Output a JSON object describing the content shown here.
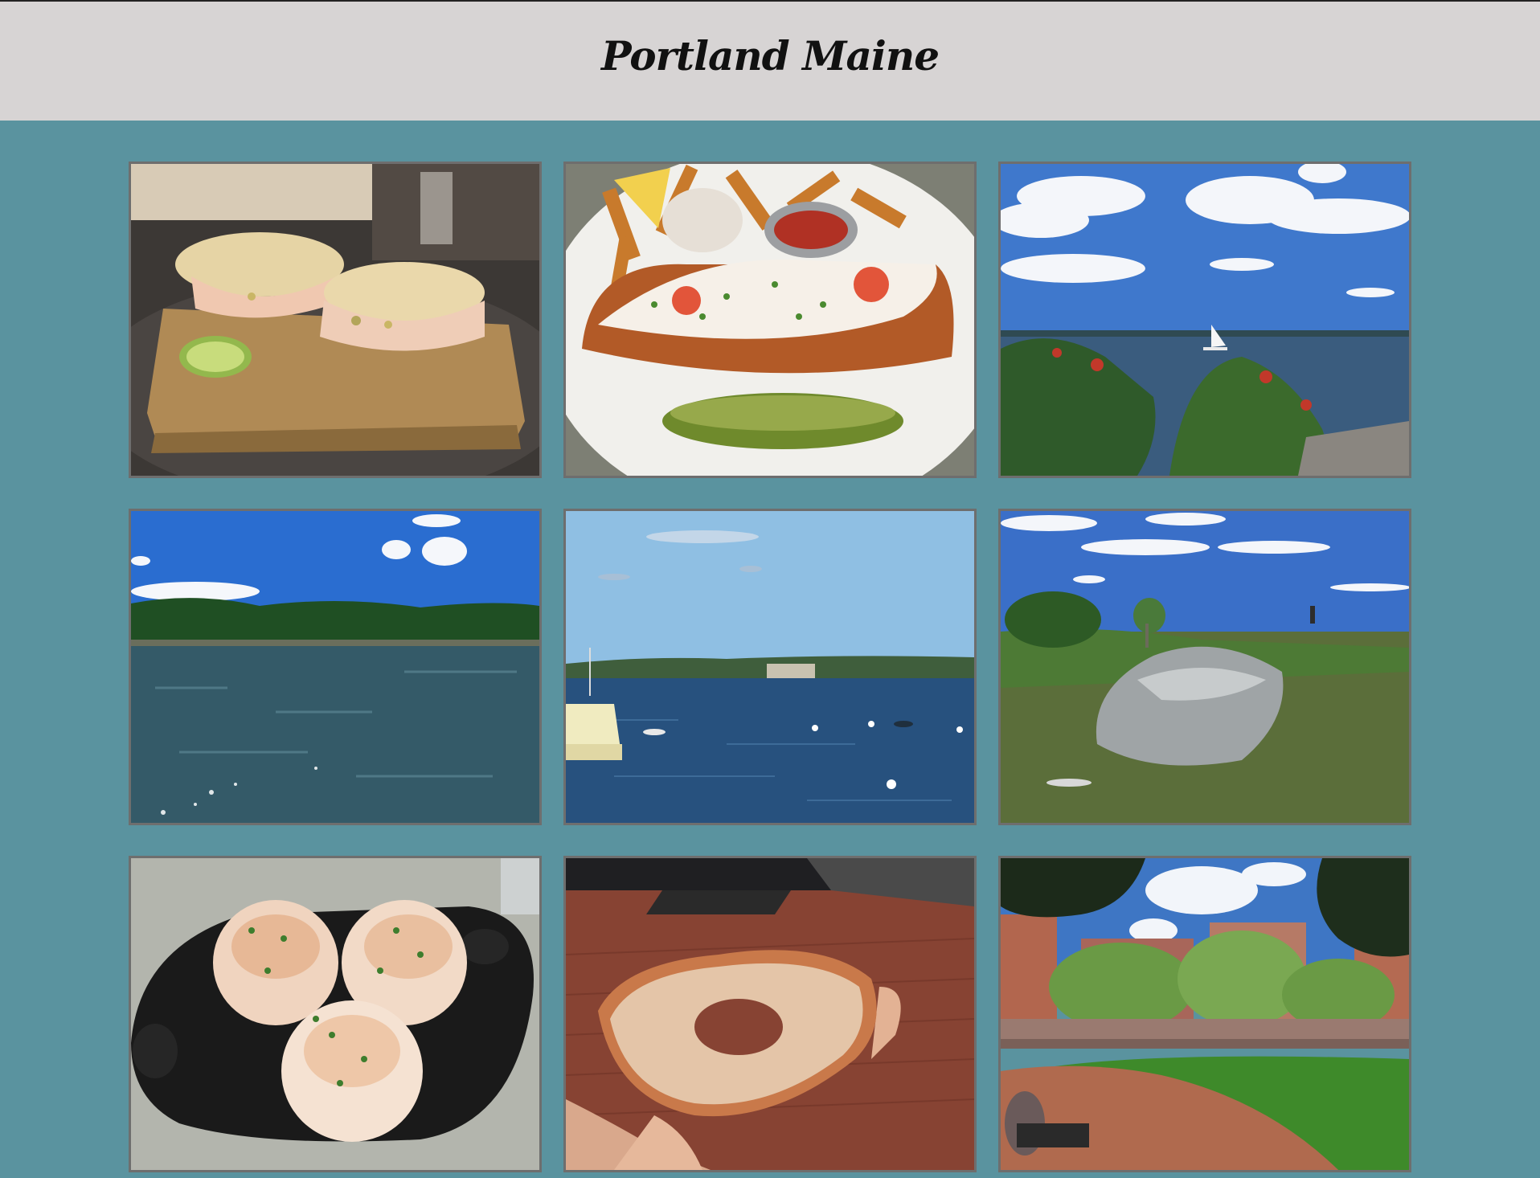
{
  "header": {
    "title": "Portland Maine"
  },
  "gallery": {
    "photos": [
      {
        "subject": "lobster-sandwich-on-board"
      },
      {
        "subject": "lobster-roll-with-fries"
      },
      {
        "subject": "harbor-with-sailboat-and-clouds"
      },
      {
        "subject": "river-with-treeline"
      },
      {
        "subject": "bay-with-fort-and-boats"
      },
      {
        "subject": "park-with-stone-sculpture"
      },
      {
        "subject": "rolls-in-cast-iron-pan"
      },
      {
        "subject": "glazed-donut-in-hand"
      },
      {
        "subject": "city-park-square"
      }
    ]
  }
}
